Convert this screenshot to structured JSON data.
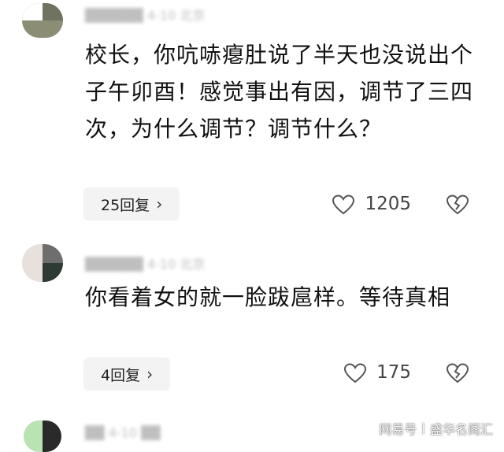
{
  "comments": [
    {
      "meta_redacted": "██████ 4-10 北京",
      "text": "校长，你吭哧瘪肚说了半天也没说出个子午卯酉！感觉事出有因，调节了三四次，为什么调节？调节什么？",
      "reply_label": "25回复",
      "likes": "1205"
    },
    {
      "meta_redacted": "██████ 4-10 北京",
      "text": "你看着女的就一脸跋扈样。等待真相",
      "reply_label": "4回复",
      "likes": "175"
    }
  ],
  "third_comment": {
    "meta_redacted": "██ 4-10 ██"
  },
  "icons": {
    "like": "heart-outline-icon",
    "dislike": "broken-heart-icon",
    "reply_chevron": "chevron-right-icon"
  },
  "watermark": {
    "brand": "网易号",
    "separator": "|",
    "account": "盛华名阁汇"
  },
  "colors": {
    "text": "#111111",
    "button_bg": "#f3f3f3",
    "icon": "#444444"
  }
}
